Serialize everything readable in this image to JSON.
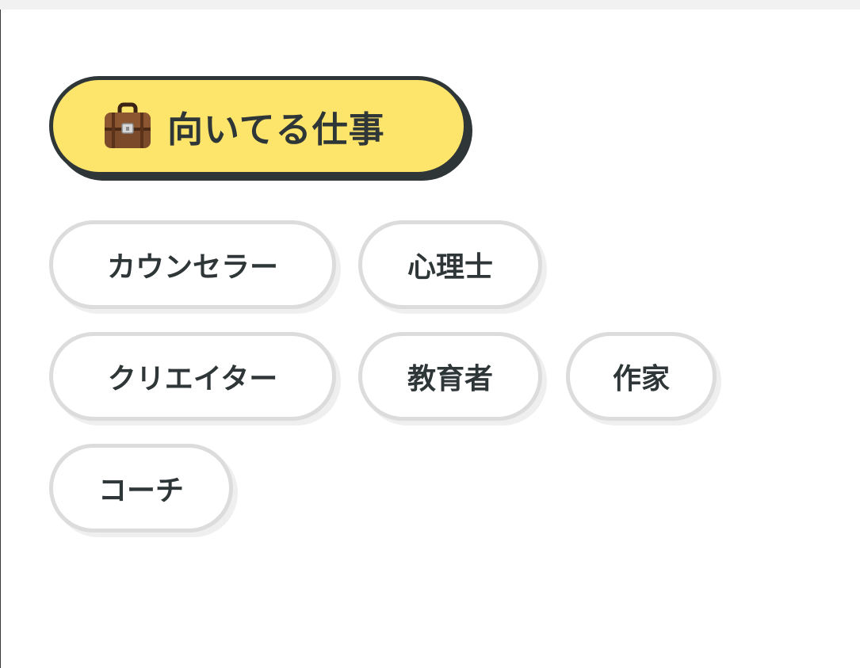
{
  "section": {
    "icon": "briefcase-icon",
    "title": "向いてる仕事"
  },
  "jobs": [
    "カウンセラー",
    "心理士",
    "クリエイター",
    "教育者",
    "作家",
    "コーチ"
  ],
  "colors": {
    "accent": "#fde46a",
    "outline": "#2f3638",
    "tag_border": "#dcdcdc",
    "text": "#2f3638"
  }
}
